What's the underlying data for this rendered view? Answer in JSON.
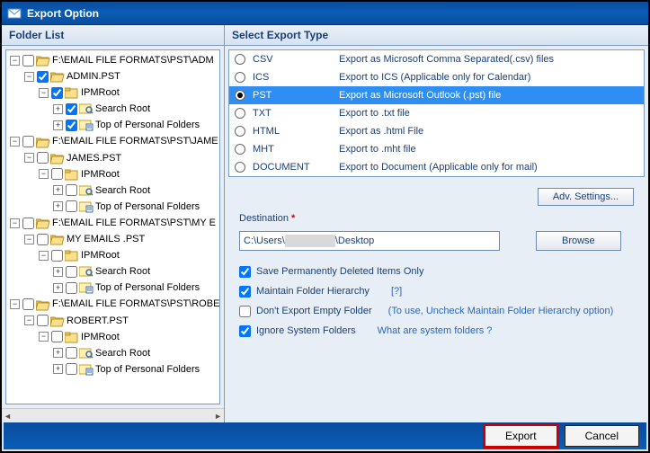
{
  "title": "Export Option",
  "left": {
    "header": "Folder List",
    "nodes": [
      {
        "label": "F:\\EMAIL FILE FORMATS\\PST\\ADM",
        "checked": false,
        "type": "folder-open",
        "children": [
          {
            "label": "ADMIN.PST",
            "checked": true,
            "type": "folder-open",
            "children": [
              {
                "label": "IPMRoot",
                "checked": true,
                "type": "folder",
                "children": [
                  {
                    "label": "Search Root",
                    "checked": true,
                    "type": "search"
                  },
                  {
                    "label": "Top of Personal Folders",
                    "checked": true,
                    "type": "pf"
                  }
                ]
              }
            ]
          }
        ]
      },
      {
        "label": "F:\\EMAIL FILE FORMATS\\PST\\JAME",
        "checked": false,
        "type": "folder-open",
        "children": [
          {
            "label": "JAMES.PST",
            "checked": false,
            "type": "folder-open",
            "children": [
              {
                "label": "IPMRoot",
                "checked": false,
                "type": "folder",
                "children": [
                  {
                    "label": "Search Root",
                    "checked": false,
                    "type": "search"
                  },
                  {
                    "label": "Top of Personal Folders",
                    "checked": false,
                    "type": "pf"
                  }
                ]
              }
            ]
          }
        ]
      },
      {
        "label": "F:\\EMAIL FILE FORMATS\\PST\\MY E",
        "checked": false,
        "type": "folder-open",
        "children": [
          {
            "label": "MY EMAILS .PST",
            "checked": false,
            "type": "folder-open",
            "children": [
              {
                "label": "IPMRoot",
                "checked": false,
                "type": "folder",
                "children": [
                  {
                    "label": "Search Root",
                    "checked": false,
                    "type": "search"
                  },
                  {
                    "label": "Top of Personal Folders",
                    "checked": false,
                    "type": "pf"
                  }
                ]
              }
            ]
          }
        ]
      },
      {
        "label": "F:\\EMAIL FILE FORMATS\\PST\\ROBE",
        "checked": false,
        "type": "folder-open",
        "children": [
          {
            "label": "ROBERT.PST",
            "checked": false,
            "type": "folder-open",
            "children": [
              {
                "label": "IPMRoot",
                "checked": false,
                "type": "folder",
                "children": [
                  {
                    "label": "Search Root",
                    "checked": false,
                    "type": "search"
                  },
                  {
                    "label": "Top of Personal Folders",
                    "checked": false,
                    "type": "pf"
                  }
                ]
              }
            ]
          }
        ]
      }
    ]
  },
  "right": {
    "header": "Select Export Type",
    "types": [
      {
        "code": "CSV",
        "desc": "Export as Microsoft Comma Separated(.csv) files",
        "selected": false
      },
      {
        "code": "ICS",
        "desc": "Export to ICS (Applicable only for Calendar)",
        "selected": false
      },
      {
        "code": "PST",
        "desc": "Export as Microsoft Outlook (.pst) file",
        "selected": true
      },
      {
        "code": "TXT",
        "desc": "Export to .txt file",
        "selected": false
      },
      {
        "code": "HTML",
        "desc": "Export as .html File",
        "selected": false
      },
      {
        "code": "MHT",
        "desc": "Export to .mht file",
        "selected": false
      },
      {
        "code": "DOCUMENT",
        "desc": "Export to Document (Applicable only for mail)",
        "selected": false
      }
    ],
    "adv_button": "Adv. Settings...",
    "dest_label": "Destination",
    "dest_prefix": "C:\\Users\\",
    "dest_suffix": "\\Desktop",
    "browse": "Browse",
    "options": {
      "save_deleted": {
        "label": "Save Permanently Deleted Items Only",
        "checked": true
      },
      "maintain_hierarchy": {
        "label": "Maintain Folder Hierarchy",
        "checked": true,
        "help": "[?]"
      },
      "dont_export_empty": {
        "label": "Don't Export Empty Folder",
        "checked": false,
        "hint": "(To use, Uncheck Maintain Folder Hierarchy option)"
      },
      "ignore_system": {
        "label": "Ignore System Folders",
        "checked": true,
        "link": "What are system folders ?"
      }
    }
  },
  "footer": {
    "export": "Export",
    "cancel": "Cancel"
  }
}
